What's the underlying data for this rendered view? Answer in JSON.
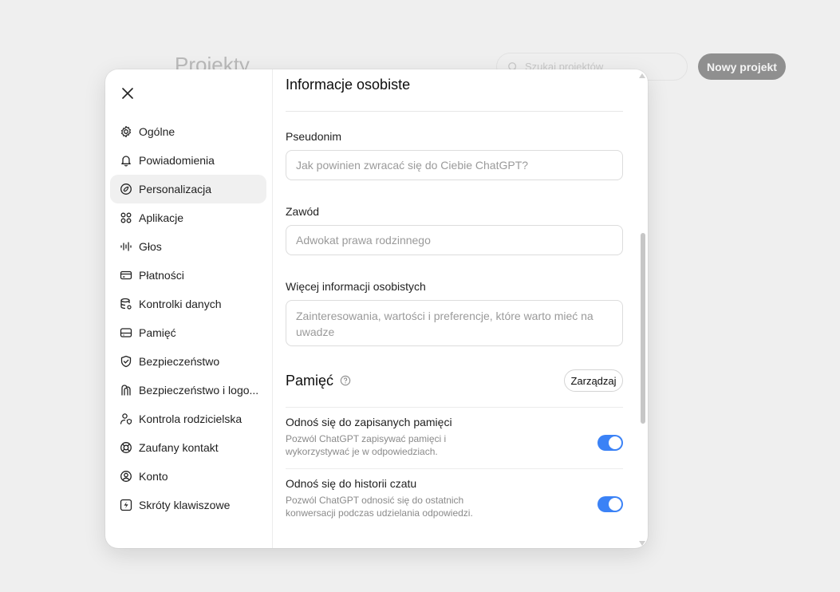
{
  "background": {
    "page_title": "Projekty",
    "search_placeholder": "Szukaj projektów",
    "new_project_label": "Nowy projekt"
  },
  "sidebar": {
    "items": [
      {
        "label": "Ogólne",
        "icon": "gear-icon"
      },
      {
        "label": "Powiadomienia",
        "icon": "bell-icon"
      },
      {
        "label": "Personalizacja",
        "icon": "personalization-icon",
        "active": true
      },
      {
        "label": "Aplikacje",
        "icon": "apps-icon"
      },
      {
        "label": "Głos",
        "icon": "voice-icon"
      },
      {
        "label": "Płatności",
        "icon": "card-icon"
      },
      {
        "label": "Kontrolki danych",
        "icon": "database-icon"
      },
      {
        "label": "Pamięć",
        "icon": "memory-icon"
      },
      {
        "label": "Bezpieczeństwo",
        "icon": "shield-icon"
      },
      {
        "label": "Bezpieczeństwo i logo...",
        "icon": "login-security-icon"
      },
      {
        "label": "Kontrola rodzicielska",
        "icon": "parental-icon"
      },
      {
        "label": "Zaufany kontakt",
        "icon": "lifebuoy-icon"
      },
      {
        "label": "Konto",
        "icon": "account-icon"
      },
      {
        "label": "Skróty klawiszowe",
        "icon": "shortcut-icon"
      }
    ]
  },
  "main": {
    "section_title": "Informacje osobiste",
    "nickname": {
      "label": "Pseudonim",
      "value": "",
      "placeholder": "Jak powinien zwracać się do Ciebie ChatGPT?"
    },
    "occupation": {
      "label": "Zawód",
      "value": "",
      "placeholder": "Adwokat prawa rodzinnego"
    },
    "more_info": {
      "label": "Więcej informacji osobistych",
      "value": "",
      "placeholder": "Zainteresowania, wartości i preferencje, które warto mieć na uwadze"
    },
    "memory": {
      "title": "Pamięć",
      "manage_label": "Zarządzaj",
      "options": [
        {
          "title": "Odnoś się do zapisanych pamięci",
          "desc": "Pozwól ChatGPT zapisywać pamięci i wykorzystywać je w odpowiedziach.",
          "enabled": true
        },
        {
          "title": "Odnoś się do historii czatu",
          "desc": "Pozwól ChatGPT odnosić się do ostatnich konwersacji podczas udzielania odpowiedzi.",
          "enabled": true
        }
      ]
    }
  },
  "colors": {
    "toggle_on": "#3b82f6",
    "active_item_bg": "#f0f0f0"
  }
}
